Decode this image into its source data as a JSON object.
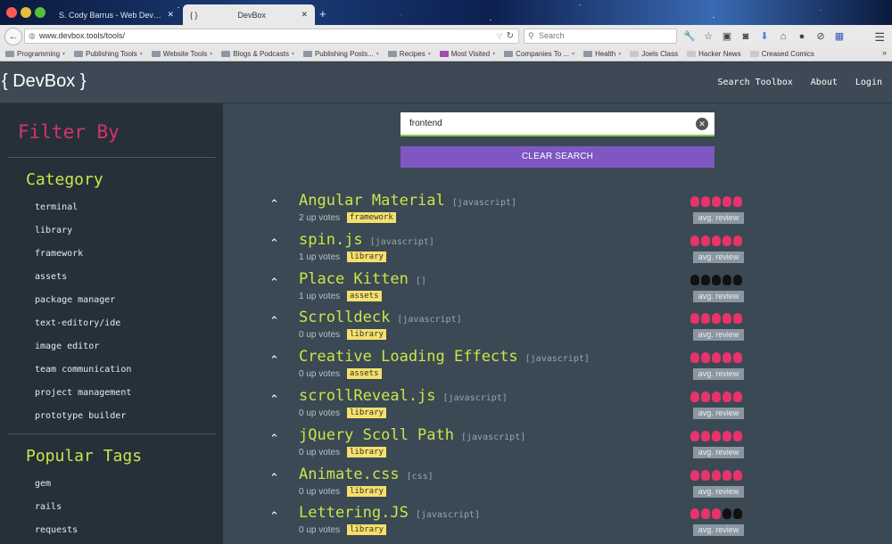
{
  "browser": {
    "tabs": [
      {
        "title": "S. Cody Barrus - Web Develope...",
        "active": false
      },
      {
        "title": "DevBox",
        "active": true,
        "favicon": "{ }"
      }
    ],
    "url": "www.devbox.tools/tools/",
    "search_placeholder": "Search",
    "bookmarks": [
      "Programming",
      "Publishing Tools",
      "Website Tools",
      "Blogs & Podcasts",
      "Publishing Posts...",
      "Recipes",
      "Most Visited",
      "Companies To ...",
      "Health",
      "Joels Class",
      "Hacker News",
      "Creased Comics"
    ]
  },
  "header": {
    "logo": "{ DevBox }",
    "nav": [
      "Search Toolbox",
      "About",
      "Login"
    ]
  },
  "sidebar": {
    "title": "Filter By",
    "category_heading": "Category",
    "categories": [
      "terminal",
      "library",
      "framework",
      "assets",
      "package manager",
      "text-editory/ide",
      "image editor",
      "team communication",
      "project management",
      "prototype builder"
    ],
    "tags_heading": "Popular Tags",
    "tags": [
      "gem",
      "rails",
      "requests"
    ]
  },
  "search": {
    "value": "frontend",
    "clear_label": "CLEAR SEARCH"
  },
  "tools": [
    {
      "name": "Angular Material",
      "lang": "[javascript]",
      "votes": "2 up votes",
      "tag": "framework",
      "rating": 5,
      "review": "avg. review"
    },
    {
      "name": "spin.js",
      "lang": "[javascript]",
      "votes": "1 up votes",
      "tag": "library",
      "rating": 5,
      "review": "avg. review"
    },
    {
      "name": "Place Kitten",
      "lang": "[]",
      "votes": "1 up votes",
      "tag": "assets",
      "rating": 0,
      "review": "avg. review"
    },
    {
      "name": "Scrolldeck",
      "lang": "[javascript]",
      "votes": "0 up votes",
      "tag": "library",
      "rating": 5,
      "review": "avg. review"
    },
    {
      "name": "Creative Loading Effects",
      "lang": "[javascript]",
      "votes": "0 up votes",
      "tag": "assets",
      "rating": 5,
      "review": "avg. review"
    },
    {
      "name": "scrollReveal.js",
      "lang": "[javascript]",
      "votes": "0 up votes",
      "tag": "library",
      "rating": 5,
      "review": "avg. review"
    },
    {
      "name": "jQuery Scoll Path",
      "lang": "[javascript]",
      "votes": "0 up votes",
      "tag": "library",
      "rating": 5,
      "review": "avg. review"
    },
    {
      "name": "Animate.css",
      "lang": "[css]",
      "votes": "0 up votes",
      "tag": "library",
      "rating": 5,
      "review": "avg. review"
    },
    {
      "name": "Lettering.JS",
      "lang": "[javascript]",
      "votes": "0 up votes",
      "tag": "library",
      "rating": 3,
      "review": "avg. review"
    }
  ],
  "colors": {
    "accent_pink": "#d6336c",
    "accent_lime": "#c8e64a",
    "button_purple": "#7e57c2",
    "tag_yellow": "#f5e06b"
  }
}
